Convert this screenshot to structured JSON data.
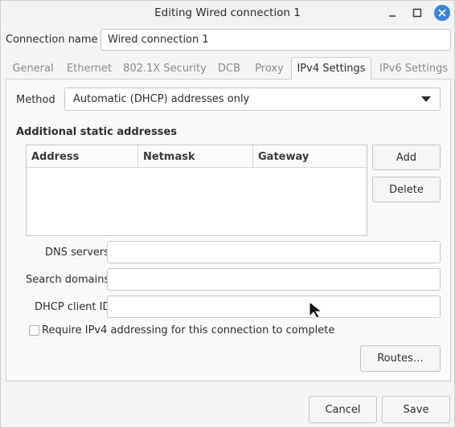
{
  "window": {
    "title": "Editing Wired connection 1"
  },
  "connection_name": {
    "label": "Connection name",
    "value": "Wired connection 1"
  },
  "tabs": [
    {
      "label": "General",
      "active": false
    },
    {
      "label": "Ethernet",
      "active": false
    },
    {
      "label": "802.1X Security",
      "active": false
    },
    {
      "label": "DCB",
      "active": false
    },
    {
      "label": "Proxy",
      "active": false
    },
    {
      "label": "IPv4 Settings",
      "active": true
    },
    {
      "label": "IPv6 Settings",
      "active": false
    }
  ],
  "ipv4": {
    "method_label": "Method",
    "method_value": "Automatic (DHCP) addresses only",
    "static_title": "Additional static addresses",
    "columns": [
      "Address",
      "Netmask",
      "Gateway"
    ],
    "add_label": "Add",
    "delete_label": "Delete",
    "dns_label": "DNS servers",
    "dns_value": "",
    "search_label": "Search domains",
    "search_value": "",
    "dhcp_label": "DHCP client ID",
    "dhcp_value": "",
    "require_label": "Require IPv4 addressing for this connection to complete",
    "require_checked": false,
    "routes_label": "Routes…"
  },
  "footer": {
    "cancel_label": "Cancel",
    "save_label": "Save"
  },
  "colors": {
    "accent": "#3584e4"
  }
}
